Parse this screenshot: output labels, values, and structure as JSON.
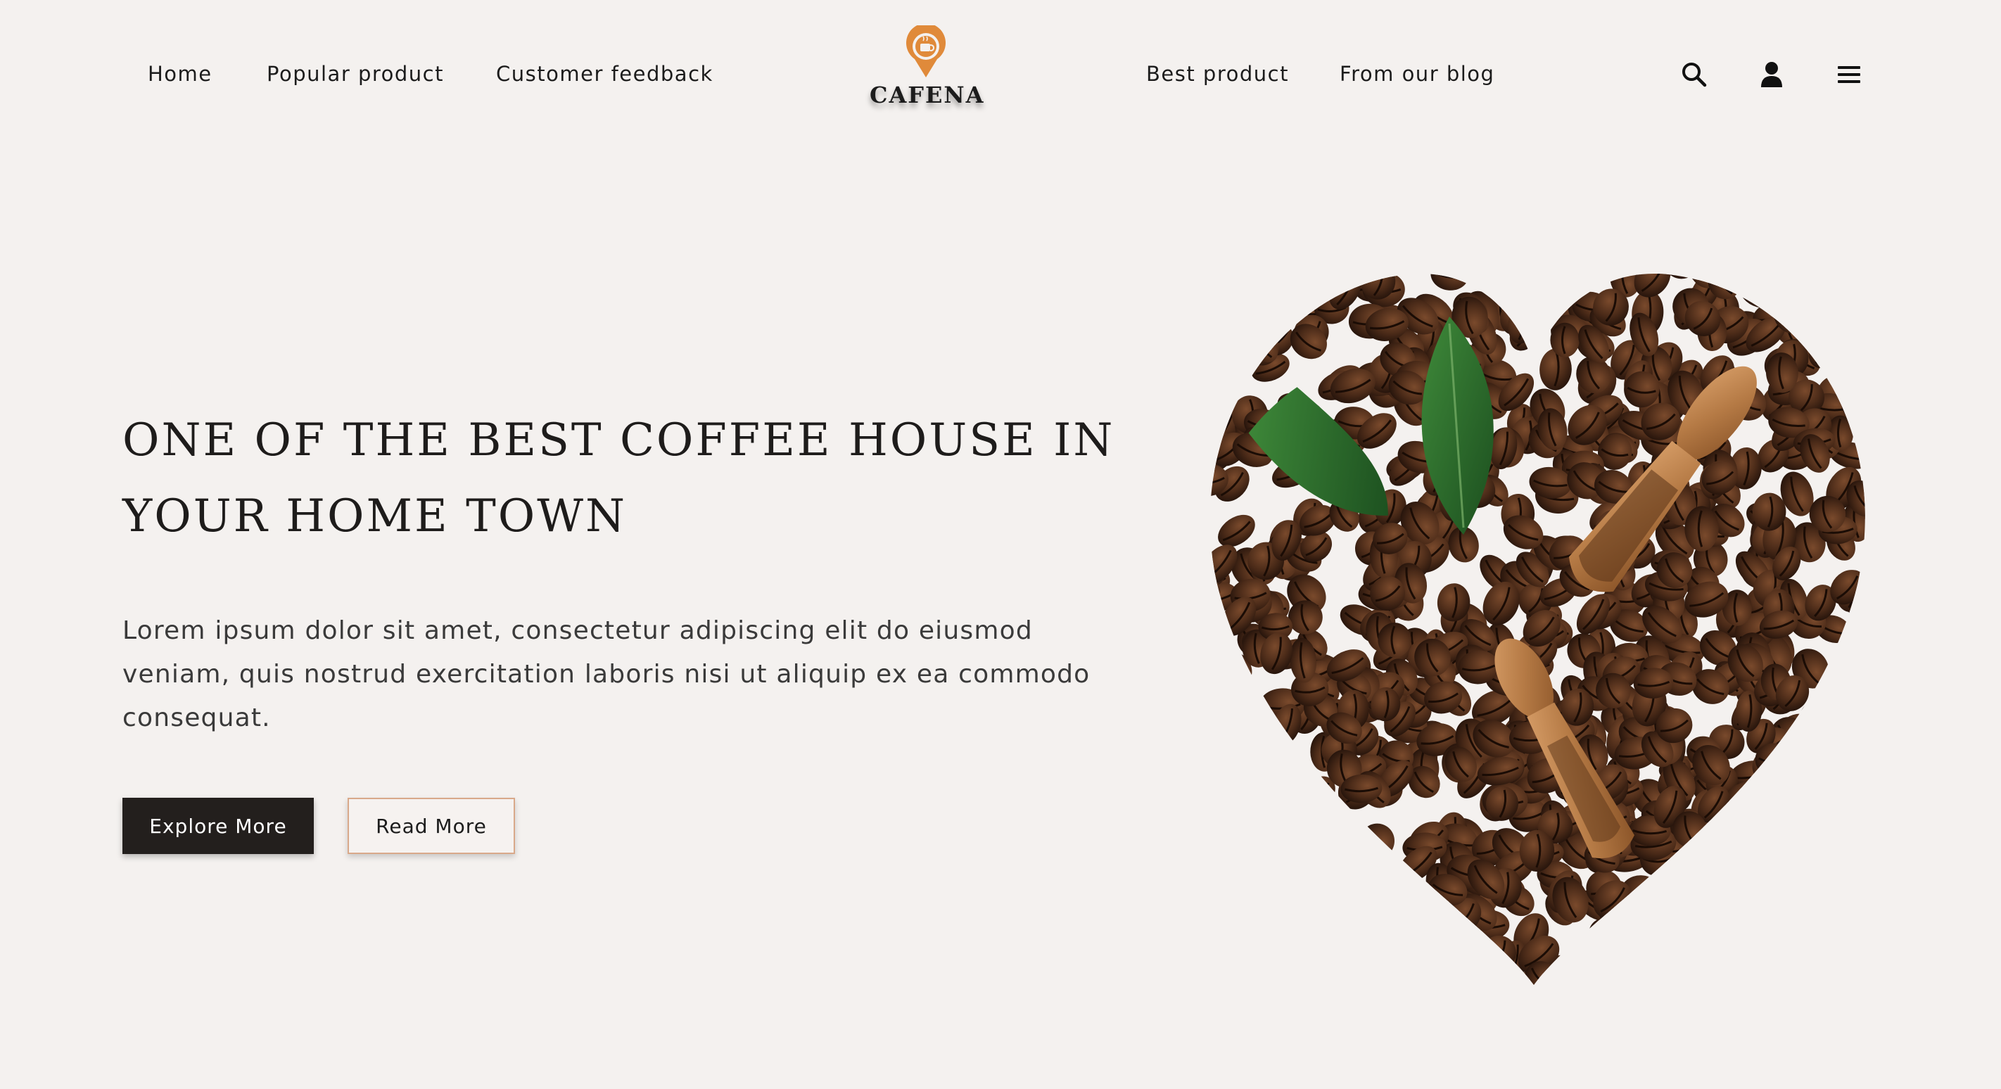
{
  "nav": {
    "left_links": [
      "Home",
      "Popular product",
      "Customer feedback"
    ],
    "right_links": [
      "Best product",
      "From our blog"
    ],
    "logo_text": "CAFENA",
    "icons": [
      "search-icon",
      "user-icon",
      "menu-icon"
    ]
  },
  "hero": {
    "title_line1": "ONE OF THE BEST COFFEE HOUSE IN",
    "title_line2": "YOUR HOME TOWN",
    "text": "Lorem ipsum dolor sit amet, consectetur adipiscing elit do eiusmod veniam, quis nostrud exercitation laboris nisi ut aliquip ex ea commodo consequat.",
    "explore_label": "Explore More",
    "read_label": "Read More",
    "image_name": "coffee-beans-heart-image"
  },
  "colors": {
    "background": "#f4f1ef",
    "accent": "#e08a3a",
    "dark_button": "#231f1d",
    "outline_border": "#d9a98a",
    "text": "#1c1c1c"
  }
}
